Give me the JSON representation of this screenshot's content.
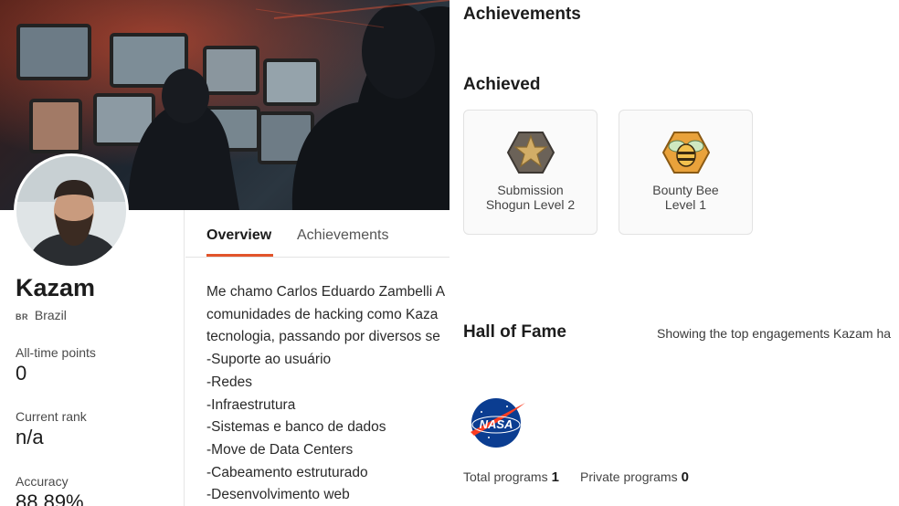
{
  "profile": {
    "username": "Kazam",
    "country_code": "BR",
    "country": "Brazil",
    "stats": [
      {
        "label": "All-time points",
        "value": "0"
      },
      {
        "label": "Current rank",
        "value": "n/a"
      },
      {
        "label": "Accuracy",
        "value": "88.89%"
      }
    ]
  },
  "tabs": [
    {
      "label": "Overview",
      "active": true
    },
    {
      "label": "Achievements",
      "active": false
    }
  ],
  "about_lines": [
    "Me chamo Carlos Eduardo Zambelli A",
    "comunidades de hacking como Kaza",
    "tecnologia, passando por diversos se",
    "-Suporte ao usuário",
    "-Redes",
    "-Infraestrutura",
    "-Sistemas e banco de dados",
    "-Move de Data Centers",
    "-Cabeamento estruturado",
    "-Desenvolvimento web"
  ],
  "achievements": {
    "title": "Achievements",
    "achieved_title": "Achieved",
    "badges": [
      {
        "line1": "Submission",
        "line2": "Shogun Level 2",
        "icon": "star-badge-icon"
      },
      {
        "line1": "Bounty Bee",
        "line2": "Level 1",
        "icon": "bee-badge-icon"
      }
    ]
  },
  "hall_of_fame": {
    "title": "Hall of Fame",
    "description": "Showing the top engagements Kazam ha",
    "logo_text": "NASA",
    "total_programs_label": "Total programs",
    "total_programs": "1",
    "private_programs_label": "Private programs",
    "private_programs": "0"
  },
  "colors": {
    "accent": "#e2542b",
    "badge_star": "#c9a45c",
    "badge_bee": "#e9a23b",
    "nasa_blue": "#0b3d91",
    "nasa_red": "#fc3d21"
  }
}
